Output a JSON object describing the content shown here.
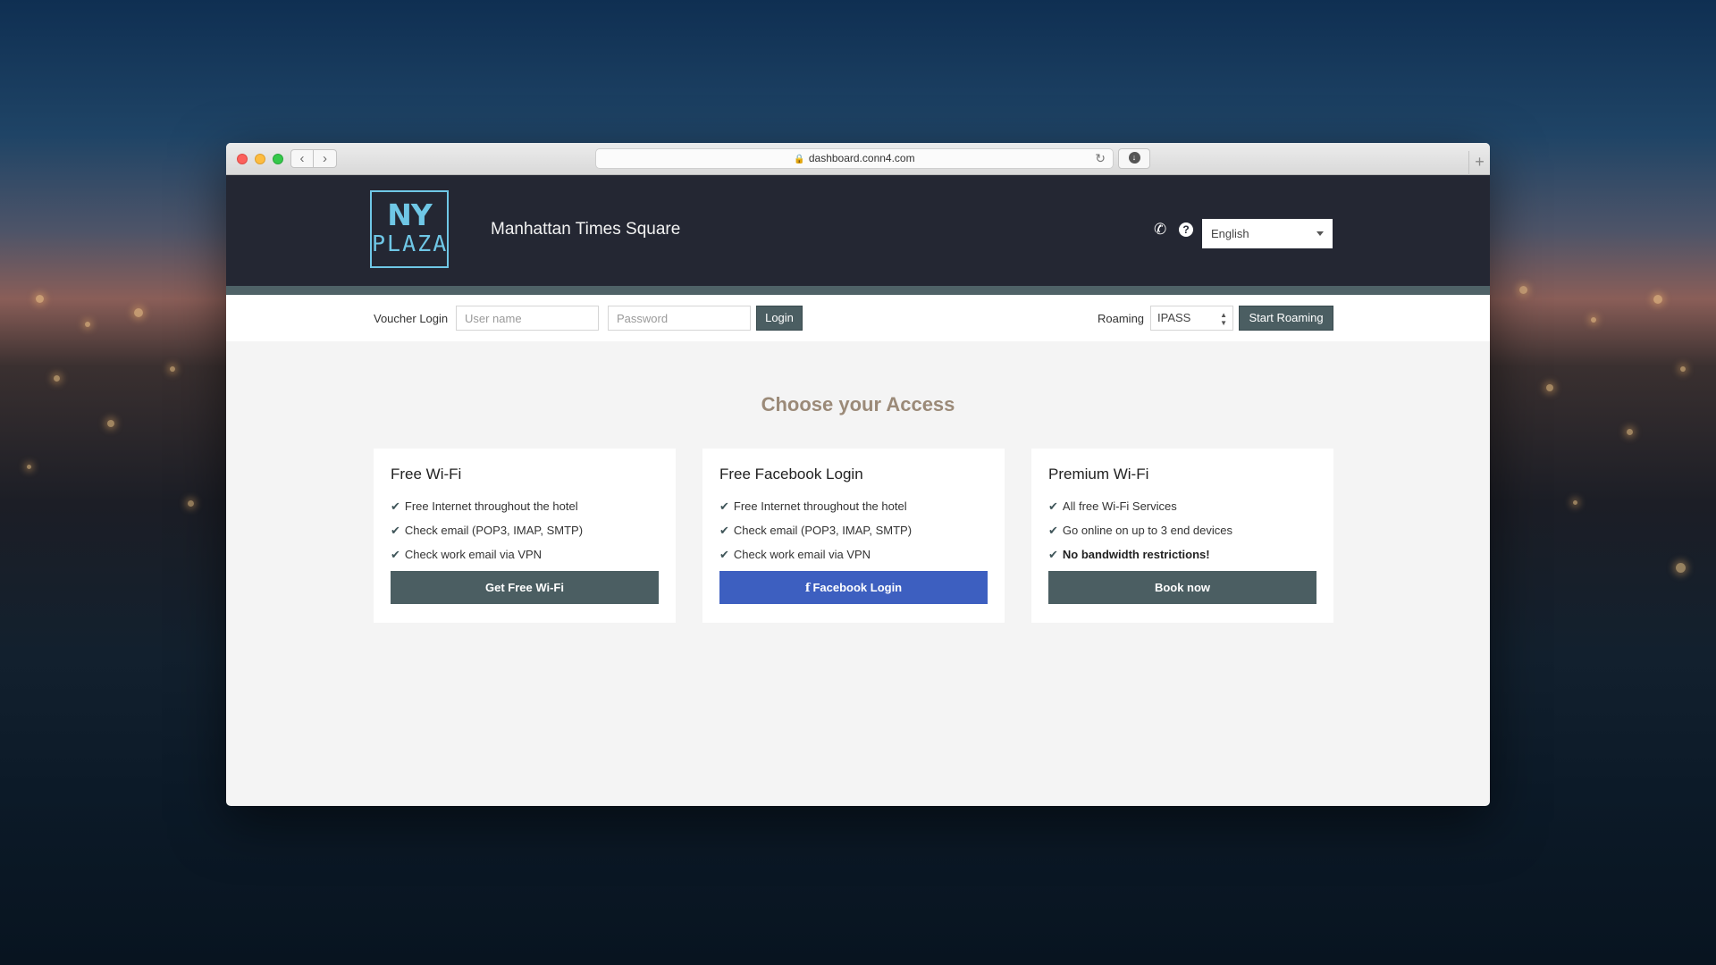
{
  "browser": {
    "url": "dashboard.conn4.com",
    "back_icon": "‹",
    "forward_icon": "›",
    "new_tab_icon": "+"
  },
  "header": {
    "logo_line1": "NY",
    "logo_line2": "PLAZA",
    "hotel_name": "Manhattan Times Square",
    "language": "English",
    "phone_icon": "phone-icon",
    "help_icon": "question-circle-icon"
  },
  "voucher_bar": {
    "label": "Voucher Login",
    "username_placeholder": "User name",
    "password_placeholder": "Password",
    "login_label": "Login",
    "roaming_label": "Roaming",
    "roaming_value": "IPASS",
    "start_roaming_label": "Start Roaming"
  },
  "main": {
    "title": "Choose your Access",
    "cards": [
      {
        "title": "Free Wi-Fi",
        "features": [
          "Free Internet throughout the hotel",
          "Check email (POP3, IMAP, SMTP)",
          "Check work email via VPN"
        ],
        "button": "Get Free Wi-Fi"
      },
      {
        "title": "Free Facebook Login",
        "features": [
          "Free Internet throughout the hotel",
          "Check email (POP3, IMAP, SMTP)",
          "Check work email via VPN"
        ],
        "button": "Facebook Login"
      },
      {
        "title": "Premium Wi-Fi",
        "features": [
          "All free Wi-Fi Services",
          "Go online on up to 3 end devices",
          "No bandwidth restrictions!"
        ],
        "button": "Book now"
      }
    ]
  },
  "colors": {
    "header_bg": "#242733",
    "accent_slate": "#4b5e62",
    "facebook_blue": "#3d5fc0",
    "logo_cyan": "#6fc7e6",
    "title_tan": "#9b8a78"
  }
}
